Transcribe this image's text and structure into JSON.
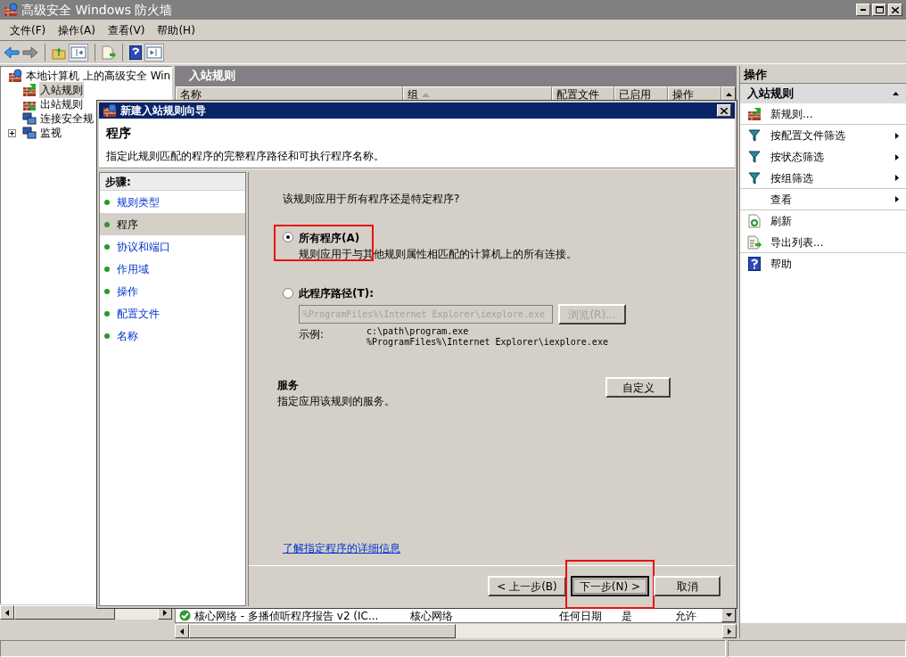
{
  "window": {
    "title": "高级安全 Windows 防火墙"
  },
  "menu": [
    {
      "label": "文件(F)"
    },
    {
      "label": "操作(A)"
    },
    {
      "label": "查看(V)"
    },
    {
      "label": "帮助(H)"
    }
  ],
  "tree": {
    "label": "本地计算机 上的高级安全 Win",
    "children": [
      {
        "label": "入站规则",
        "kind": "inbound",
        "selected": true
      },
      {
        "label": "出站规则",
        "kind": "outbound",
        "selected": false
      },
      {
        "label": "连接安全规",
        "kind": "connection",
        "selected": false
      },
      {
        "label": "监视",
        "kind": "monitor",
        "selected": false,
        "expanded": false
      }
    ]
  },
  "center": {
    "title": "入站规则",
    "columns": [
      {
        "label": "名称",
        "sorted": false
      },
      {
        "label": "组",
        "sorted": true
      },
      {
        "label": "配置文件",
        "sorted": false
      },
      {
        "label": "已启用",
        "sorted": false
      },
      {
        "label": "操作",
        "sorted": false
      }
    ],
    "rows": [
      {
        "cells": [
          "核心网络 - 多播侦听程序报告 v2 (IC...",
          "核心网络",
          "任何日期",
          "是",
          "允许"
        ],
        "enabled": true
      }
    ]
  },
  "actions": {
    "title": "操作",
    "section": "入站规则",
    "items": [
      {
        "label": "新规则...",
        "kind": "new-rule",
        "submenu": false,
        "separator_after": true
      },
      {
        "label": "按配置文件筛选",
        "kind": "filter",
        "submenu": true,
        "separator_after": false
      },
      {
        "label": "按状态筛选",
        "kind": "filter",
        "submenu": true,
        "separator_after": false
      },
      {
        "label": "按组筛选",
        "kind": "filter",
        "submenu": true,
        "separator_after": true
      },
      {
        "label": "查看",
        "kind": "plain",
        "submenu": true,
        "separator_after": true
      },
      {
        "label": "刷新",
        "kind": "refresh",
        "submenu": false,
        "separator_after": false
      },
      {
        "label": "导出列表...",
        "kind": "export",
        "submenu": false,
        "separator_after": true
      },
      {
        "label": "帮助",
        "kind": "help",
        "submenu": false,
        "separator_after": false
      }
    ]
  },
  "dialog": {
    "title": "新建入站规则向导",
    "heading": "程序",
    "description": "指定此规则匹配的程序的完整程序路径和可执行程序名称。",
    "steps_title": "步骤:",
    "steps": [
      {
        "label": "规则类型",
        "selected": false
      },
      {
        "label": "程序",
        "selected": true
      },
      {
        "label": "协议和端口",
        "selected": false
      },
      {
        "label": "作用域",
        "selected": false
      },
      {
        "label": "操作",
        "selected": false
      },
      {
        "label": "配置文件",
        "selected": false
      },
      {
        "label": "名称",
        "selected": false
      }
    ],
    "question": "该规则应用于所有程序还是特定程序?",
    "options": [
      {
        "label": "所有程序(A)",
        "description": "规则应用于与其他规则属性相匹配的计算机上的所有连接。",
        "selected": true,
        "highlighted": true
      },
      {
        "label": "此程序路径(T):",
        "selected": false,
        "highlighted": false
      }
    ],
    "path_field": {
      "value": "%ProgramFiles%\\Internet Explorer\\iexplore.exe",
      "disabled": true
    },
    "browse_button": {
      "label": "浏览(R)...",
      "disabled": true
    },
    "example_label": "示例:",
    "examples": [
      "c:\\path\\program.exe",
      "%ProgramFiles%\\Internet Explorer\\iexplore.exe"
    ],
    "services": {
      "title": "服务",
      "description": "指定应用该规则的服务。",
      "button": "自定义"
    },
    "link": "了解指定程序的详细信息",
    "buttons": [
      {
        "label": "< 上一步(B)",
        "default": false,
        "highlighted": false
      },
      {
        "label": "下一步(N) >",
        "default": true,
        "highlighted": true
      },
      {
        "label": "取消",
        "default": false,
        "highlighted": false
      }
    ]
  }
}
